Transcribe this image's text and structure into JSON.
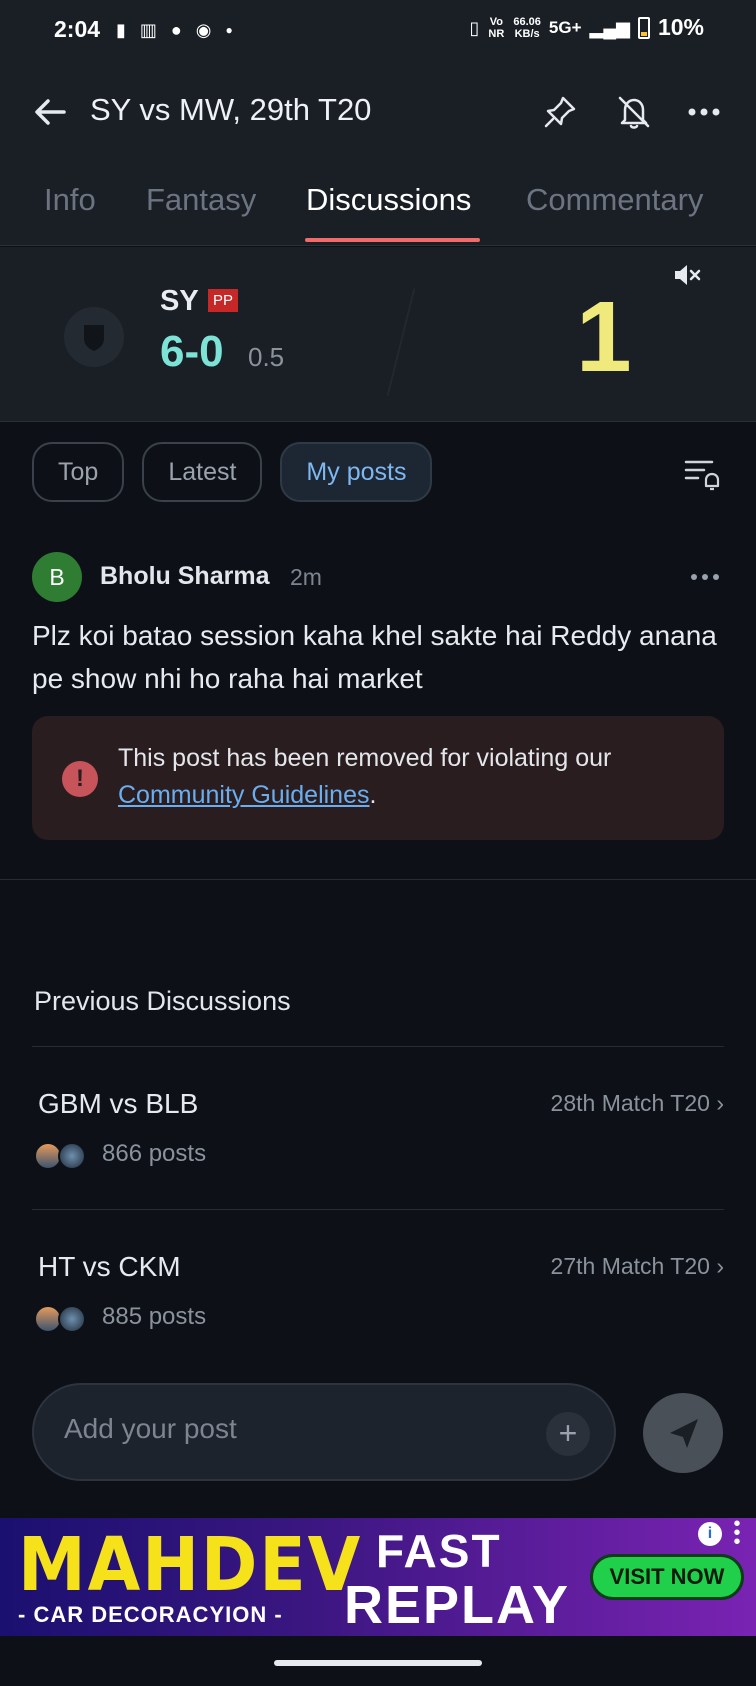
{
  "status_bar": {
    "time": "2:04",
    "net_speed_value": "66.06",
    "net_speed_unit": "KB/s",
    "volte": "Vo NR",
    "network": "5G+",
    "battery": "10%"
  },
  "header": {
    "title": "SY vs MW, 29th T20"
  },
  "tabs": [
    {
      "label": "Info"
    },
    {
      "label": "Fantasy"
    },
    {
      "label": "Discussions",
      "active": true
    },
    {
      "label": "Commentary"
    }
  ],
  "score": {
    "team": "SY",
    "badge": "PP",
    "runs": "6-0",
    "overs": "0.5",
    "ball_result": "1"
  },
  "filters": {
    "chips": [
      {
        "label": "Top"
      },
      {
        "label": "Latest"
      },
      {
        "label": "My posts",
        "active": true
      }
    ]
  },
  "post": {
    "avatar_letter": "B",
    "author": "Bholu Sharma",
    "time": "2m",
    "text": "Plz koi batao session kaha khel sakte hai Reddy anana pe show nhi ho raha hai market",
    "removed_notice": "This post has been removed for violating our",
    "removed_link": "Community Guidelines",
    "removed_suffix": "."
  },
  "previous": {
    "title": "Previous Discussions",
    "items": [
      {
        "name": "GBM vs BLB",
        "match": "28th Match T20 ›",
        "posts": "866 posts"
      },
      {
        "name": "HT vs CKM",
        "match": "27th Match T20 ›",
        "posts": "885 posts"
      }
    ]
  },
  "composer": {
    "placeholder": "Add your post",
    "plus": "+"
  },
  "ad": {
    "brand": "MAHDEV",
    "brand_sub": "- CAR DECORACYION -",
    "line1": "FAST",
    "line2": "REPLAY",
    "cta": "VISIT NOW",
    "info": "i"
  },
  "colors": {
    "background": "#0d1117",
    "header_bg": "#1a1f26",
    "tab_underline": "#f26b6b",
    "runs": "#7de3d6",
    "ball_result": "#f0ea7c",
    "link": "#6aaeef",
    "removed_bg": "#2a1d20"
  },
  "icons": [
    "back-arrow-icon",
    "pin-icon",
    "bell-off-icon",
    "more-icon",
    "mute-icon",
    "filter-bell-icon",
    "alert-icon",
    "send-icon",
    "plus-icon",
    "info-icon"
  ]
}
